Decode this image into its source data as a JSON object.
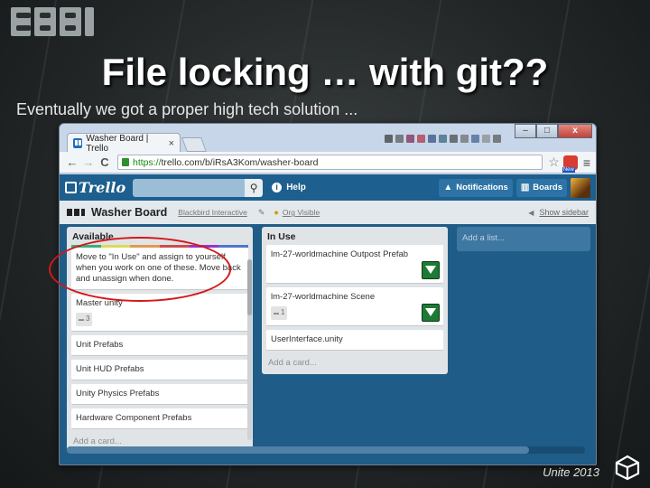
{
  "slide": {
    "title": "File locking … with git??",
    "subtitle": "Eventually we got a proper high tech solution ...",
    "footer": "Unite 2013",
    "logo_icon": "bbi-logo",
    "footer_icon": "unity-logo-icon"
  },
  "browser": {
    "tab_title": "Washer Board | Trello",
    "tab_close": "×",
    "url_scheme": "https://",
    "url_host_path": "trello.com/b/iRsA3Kom/washer-board",
    "back_glyph": "←",
    "forward_glyph": "→",
    "reload_glyph": "C",
    "star_glyph": "☆",
    "menu_glyph": "≡",
    "ext_badge": "New",
    "win_min": "–",
    "win_max": "□",
    "win_close": "x"
  },
  "trello": {
    "logo_text": "Trello",
    "search_placeholder": "",
    "search_glyph": "⚲",
    "help_label": "Help",
    "notifications_label": "Notifications",
    "boards_label": "Boards",
    "board_name": "Washer Board",
    "board_org": "Blackbird Interactive",
    "org_visible": "Org Visible",
    "show_sidebar": "Show sidebar",
    "add_list": "Add a list...",
    "label_colors": [
      "#34b27d",
      "#dbdb57",
      "#e09952",
      "#cb4d4d",
      "#93c",
      "#4d77cb"
    ]
  },
  "lists": [
    {
      "title": "Available",
      "cards": [
        {
          "text": "Move to \"In Use\" and assign to yourself when you work on one of these. Move back and unassign when done.",
          "labels": true
        },
        {
          "text": "Master unity",
          "badge": "3"
        },
        {
          "text": "Unit Prefabs"
        },
        {
          "text": "Unit HUD Prefabs"
        },
        {
          "text": "Unity Physics Prefabs"
        },
        {
          "text": "Hardware Component Prefabs"
        }
      ],
      "add_card": "Add a card..."
    },
    {
      "title": "In Use",
      "cards": [
        {
          "text": "lm-27-worldmachine Outpost Prefab",
          "member": true
        },
        {
          "text": "lm-27-worldmachine Scene",
          "badge": "1",
          "member": true
        },
        {
          "text": "UserInterface.unity"
        }
      ],
      "add_card": "Add a card..."
    }
  ]
}
